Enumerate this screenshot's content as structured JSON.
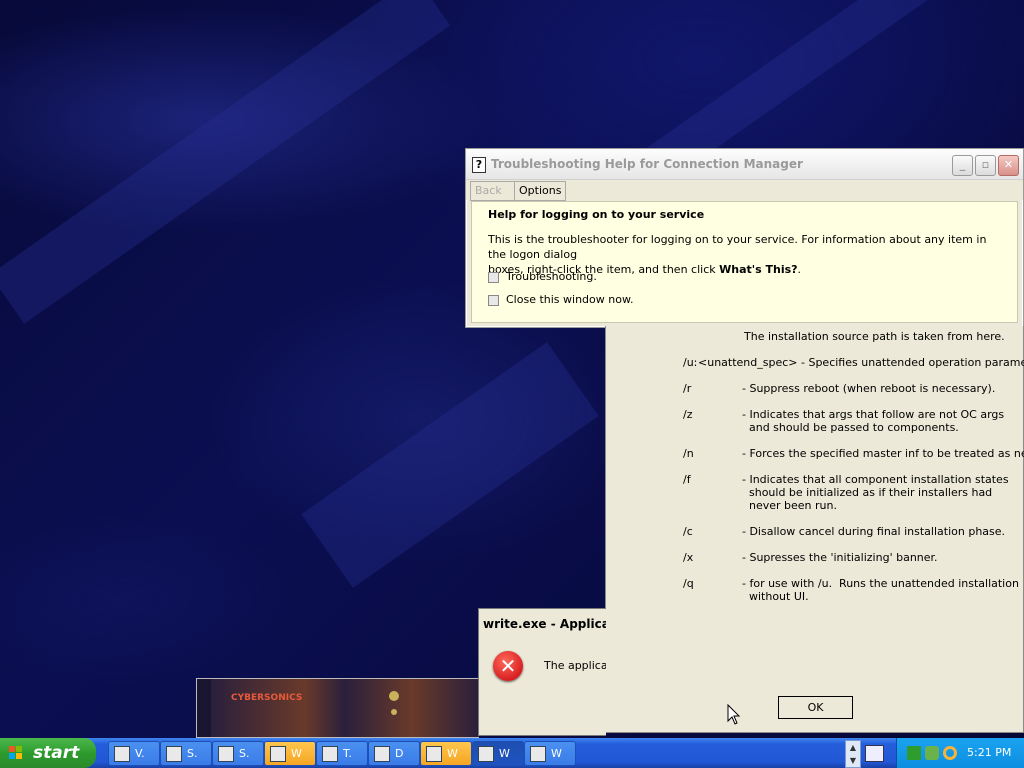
{
  "help_window": {
    "title": "Troubleshooting Help for Connection Manager",
    "back_label": "Back",
    "options_label": "Options",
    "heading": "Help for logging on to your service",
    "desc_1": "This is the troubleshooter for logging on to your service. For information about any item in the logon dialog",
    "desc_2": "boxes, right-click the item, and then click ",
    "desc_bold": "What's This?",
    "desc_end": ".",
    "option_1": "Troubleshooting.",
    "option_2": "Close this window now."
  },
  "usage_window": {
    "partial_line": "The installation source path is taken from here.",
    "rows": [
      {
        "switch": "/u:",
        "desc": "<unattend_spec> - Specifies unattended operation parameters."
      },
      {
        "switch": "/r",
        "desc": "- Suppress reboot (when reboot is necessary)."
      },
      {
        "switch": "/z",
        "desc": "- Indicates that args that follow are not OC args\n  and should be passed to components."
      },
      {
        "switch": "/n",
        "desc": "- Forces the specified master inf to be treated as new."
      },
      {
        "switch": "/f",
        "desc": "- Indicates that all component installation states\n  should be initialized as if their installers had\n  never been run."
      },
      {
        "switch": "/c",
        "desc": "- Disallow cancel during final installation phase."
      },
      {
        "switch": "/x",
        "desc": "- Supresses the 'initializing' banner."
      },
      {
        "switch": "/q",
        "desc": "- for use with /u.  Runs the unattended installation\n  without UI."
      }
    ],
    "ok_label": "OK"
  },
  "error_window": {
    "title": "write.exe - Applicat",
    "message": "The applicati"
  },
  "partial_window": {
    "caption": "CYBERSONICS"
  },
  "taskbar": {
    "start_label": "start",
    "tasks": [
      {
        "label": "V.",
        "icon": "document-icon"
      },
      {
        "label": "S.",
        "icon": "battery-icon"
      },
      {
        "label": "S.",
        "icon": "system-icon"
      },
      {
        "label": "W",
        "icon": "writer-icon"
      },
      {
        "label": "T.",
        "icon": "window-icon"
      },
      {
        "label": "D",
        "icon": "font-icon"
      },
      {
        "label": "W",
        "icon": "ie-icon"
      },
      {
        "label": "W",
        "icon": "window-icon"
      },
      {
        "label": "W",
        "icon": "computer-icon"
      }
    ],
    "clock": "5:21 PM"
  },
  "colors": {
    "taskbar_blue": "#245edb",
    "start_green": "#2d9b2d",
    "help_yellow": "#ffffe1",
    "dialog_gray": "#ece9d8",
    "error_red": "#c8000b"
  }
}
